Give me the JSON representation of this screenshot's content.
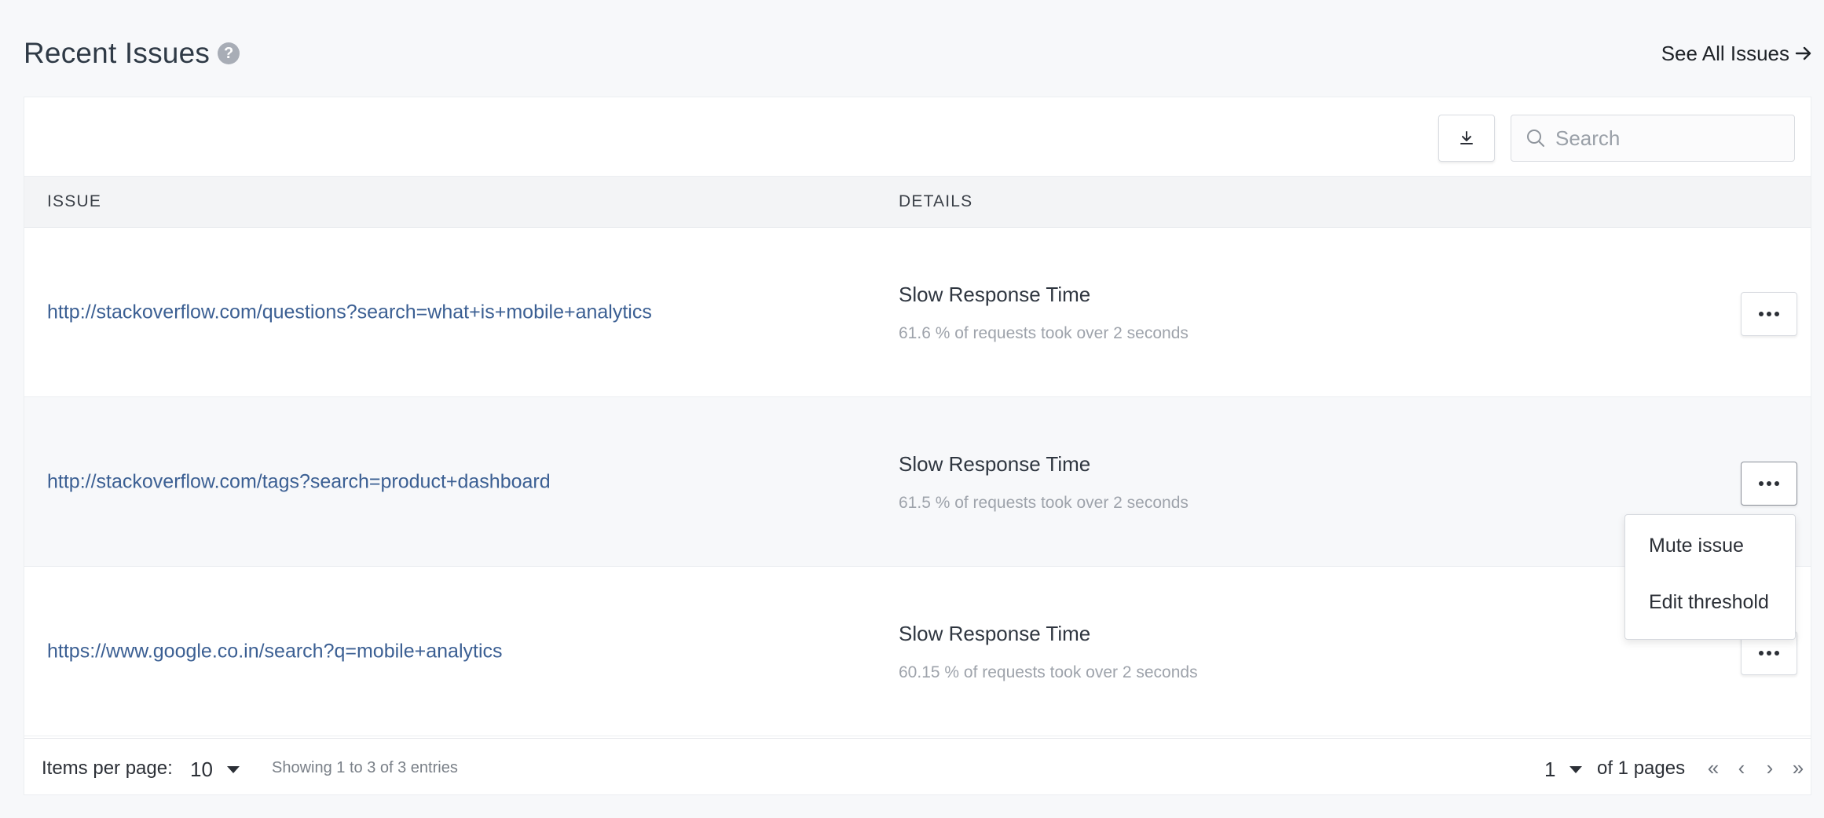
{
  "header": {
    "title": "Recent Issues",
    "help_icon": "question-circle-icon",
    "see_all_label": "See All Issues"
  },
  "toolbar": {
    "download_icon": "download-icon",
    "search_placeholder": "Search",
    "search_value": ""
  },
  "table": {
    "columns": [
      "ISSUE",
      "DETAILS"
    ],
    "rows": [
      {
        "issue": "http://stackoverflow.com/questions?search=what+is+mobile+analytics",
        "detail_title": "Slow Response Time",
        "detail_sub": "61.6 % of requests took over 2 seconds"
      },
      {
        "issue": "http://stackoverflow.com/tags?search=product+dashboard",
        "detail_title": "Slow Response Time",
        "detail_sub": "61.5 % of requests took over 2 seconds"
      },
      {
        "issue": "https://www.google.co.in/search?q=mobile+analytics",
        "detail_title": "Slow Response Time",
        "detail_sub": "60.15 % of requests took over 2 seconds"
      }
    ]
  },
  "row_menu": {
    "items": [
      "Mute issue",
      "Edit threshold"
    ]
  },
  "footer": {
    "items_per_page_label": "Items per page:",
    "items_per_page_value": "10",
    "showing_text": "Showing 1 to 3 of 3 entries",
    "page_value": "1",
    "of_pages_text": "of 1 pages",
    "first_page": "«",
    "prev_page": "‹",
    "next_page": "›",
    "last_page": "»"
  },
  "colors": {
    "link": "#3b5f93",
    "background": "#f7f8fa"
  }
}
